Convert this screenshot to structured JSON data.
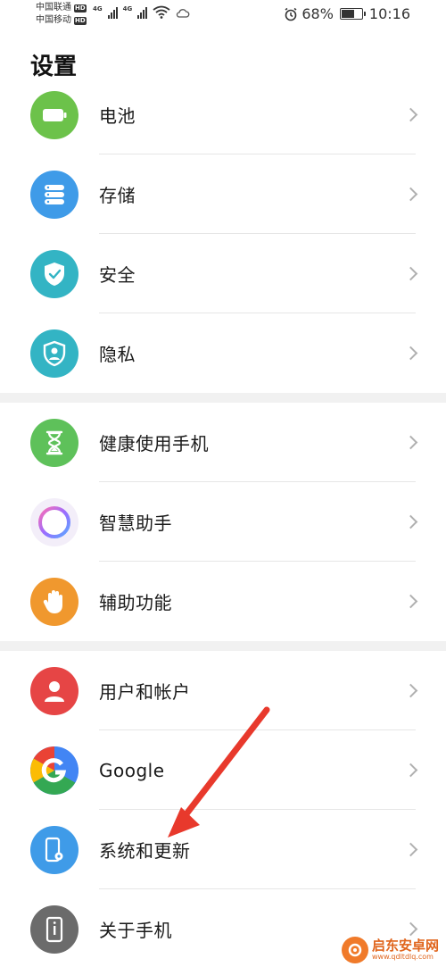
{
  "status_bar": {
    "carrier1": "中国联通",
    "carrier2": "中国移动",
    "hd_badge": "HD",
    "network_type": "4G",
    "battery_percent": "68%",
    "battery_level": 0.68,
    "time": "10:16"
  },
  "page": {
    "title": "设置"
  },
  "settings_groups": [
    {
      "items": [
        {
          "label": "电池",
          "icon": "battery-icon",
          "color": "#6cc24a"
        },
        {
          "label": "存储",
          "icon": "storage-icon",
          "color": "#3f9be8"
        },
        {
          "label": "安全",
          "icon": "shield-icon",
          "color": "#33b4c4"
        },
        {
          "label": "隐私",
          "icon": "privacy-icon",
          "color": "#33b4c4"
        }
      ]
    },
    {
      "items": [
        {
          "label": "健康使用手机",
          "icon": "hourglass-icon",
          "color": "#5ec15a"
        },
        {
          "label": "智慧助手",
          "icon": "assistant-ring-icon",
          "color": "#f3eef9"
        },
        {
          "label": "辅助功能",
          "icon": "hand-icon",
          "color": "#f0982e"
        }
      ]
    },
    {
      "items": [
        {
          "label": "用户和帐户",
          "icon": "user-icon",
          "color": "#e64545"
        },
        {
          "label": "Google",
          "icon": "google-icon",
          "color": "#4285f4"
        },
        {
          "label": "系统和更新",
          "icon": "phone-gear-icon",
          "color": "#3f9be8"
        },
        {
          "label": "关于手机",
          "icon": "phone-info-icon",
          "color": "#6b6b6b"
        }
      ]
    }
  ],
  "annotation": {
    "arrow_color": "#e8392c"
  },
  "watermark": {
    "name": "启东安卓网",
    "url": "www.qdltdlq.com"
  }
}
